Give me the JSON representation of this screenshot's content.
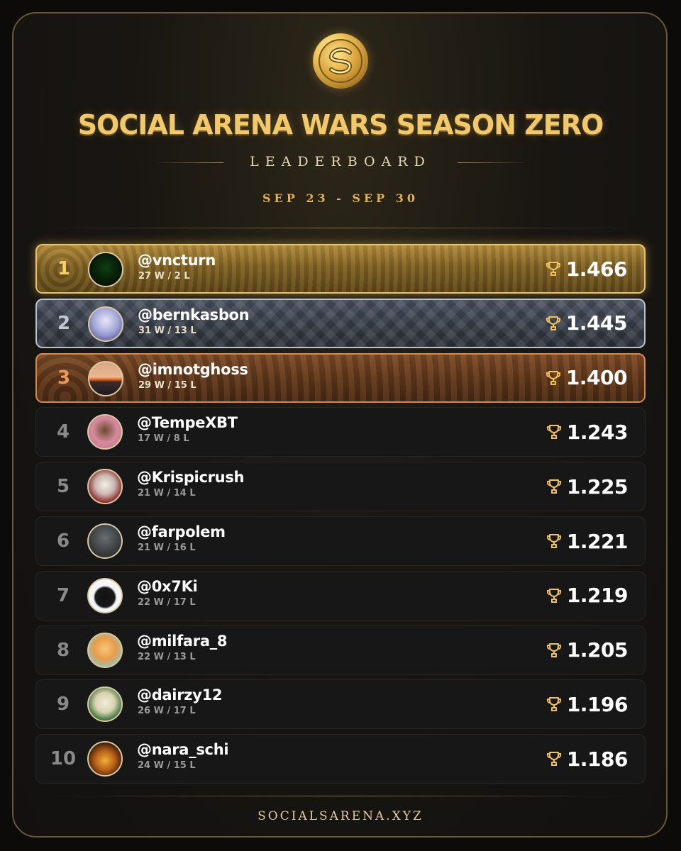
{
  "header": {
    "title": "SOCIAL ARENA WARS SEASON ZERO",
    "subtitle": "LEADERBOARD",
    "dates": "SEP 23 - SEP 30",
    "logo_icon": "coin-logo-icon"
  },
  "footer": {
    "site": "SOCIALSARENA.XYZ"
  },
  "colors": {
    "accent_gold": "#f1c96a",
    "silver": "#b9c1cc",
    "bronze": "#d7894a",
    "row_dark": "#171717"
  },
  "rows": [
    {
      "rank": "1",
      "username": "@vncturn",
      "record": "27 W / 2 L",
      "score": "1.466",
      "icon": "trophy-icon"
    },
    {
      "rank": "2",
      "username": "@bernkasbon",
      "record": "31 W / 13 L",
      "score": "1.445",
      "icon": "trophy-icon"
    },
    {
      "rank": "3",
      "username": "@imnotghoss",
      "record": "29 W / 15 L",
      "score": "1.400",
      "icon": "trophy-icon"
    },
    {
      "rank": "4",
      "username": "@TempeXBT",
      "record": "17 W / 8 L",
      "score": "1.243",
      "icon": "trophy-icon"
    },
    {
      "rank": "5",
      "username": "@Krispicrush",
      "record": "21 W / 14 L",
      "score": "1.225",
      "icon": "trophy-icon"
    },
    {
      "rank": "6",
      "username": "@farpolem",
      "record": "21 W / 16 L",
      "score": "1.221",
      "icon": "trophy-icon"
    },
    {
      "rank": "7",
      "username": "@0x7Ki",
      "record": "22 W / 17 L",
      "score": "1.219",
      "icon": "trophy-icon"
    },
    {
      "rank": "8",
      "username": "@milfara_8",
      "record": "22 W / 13 L",
      "score": "1.205",
      "icon": "trophy-icon"
    },
    {
      "rank": "9",
      "username": "@dairzy12",
      "record": "26 W / 17 L",
      "score": "1.196",
      "icon": "trophy-icon"
    },
    {
      "rank": "10",
      "username": "@nara_schi",
      "record": "24 W / 15 L",
      "score": "1.186",
      "icon": "trophy-icon"
    }
  ]
}
